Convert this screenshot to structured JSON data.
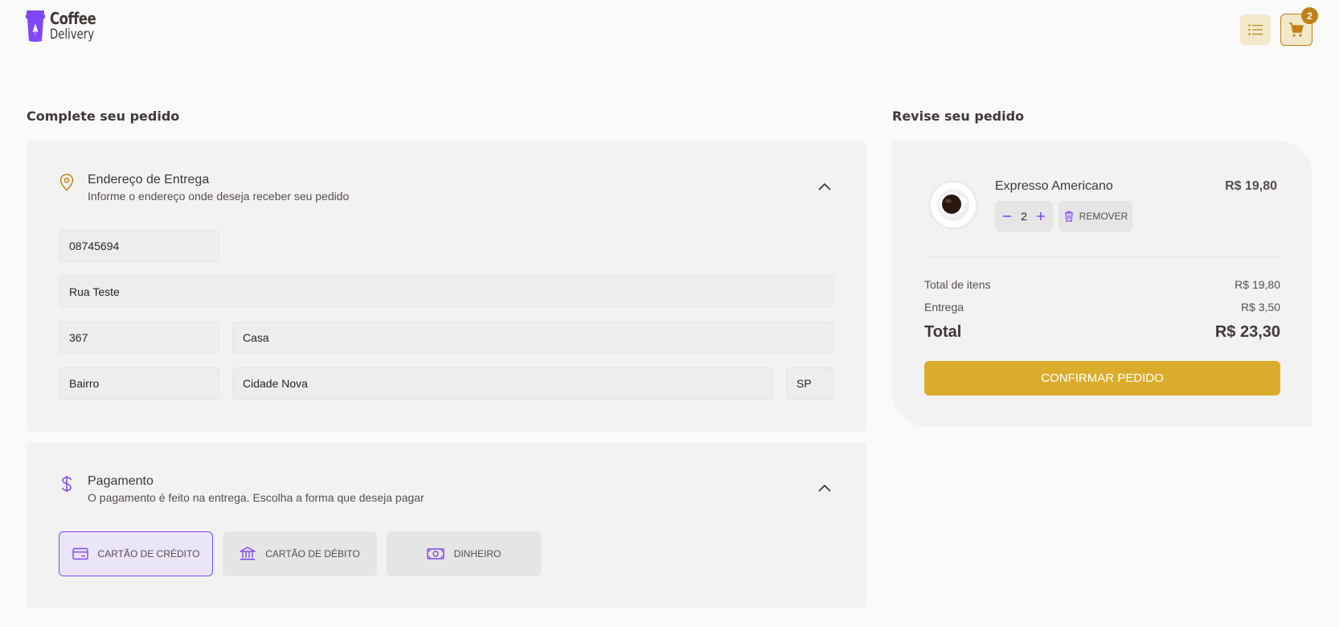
{
  "brand": {
    "line1": "Coffee",
    "line2": "Delivery"
  },
  "header": {
    "cart_count": "2"
  },
  "colors": {
    "purple": "#8047f8",
    "yellow_dark": "#c47f17",
    "yellow": "#dbac2c"
  },
  "checkout": {
    "title": "Complete seu pedido",
    "address": {
      "title": "Endereço de Entrega",
      "subtitle": "Informe o endereço onde deseja receber seu pedido",
      "cep": "08745694",
      "street": "Rua Teste",
      "number": "367",
      "complement": "Casa",
      "neighborhood": "Bairro",
      "city": "Cidade Nova",
      "uf": "SP"
    },
    "payment": {
      "title": "Pagamento",
      "subtitle": "O pagamento é feito na entrega. Escolha a forma que deseja pagar",
      "options": [
        {
          "label": "Cartão de crédito",
          "icon": "credit-card-icon",
          "selected": true
        },
        {
          "label": "Cartão de débito",
          "icon": "bank-icon",
          "selected": false
        },
        {
          "label": "Dinheiro",
          "icon": "money-icon",
          "selected": false
        }
      ]
    }
  },
  "review": {
    "title": "Revise seu pedido",
    "item": {
      "name": "Expresso Americano",
      "price": "R$ 19,80",
      "quantity": "2",
      "remove_label": "Remover"
    },
    "totals": {
      "items_label": "Total de itens",
      "items_value": "R$ 19,80",
      "delivery_label": "Entrega",
      "delivery_value": "R$ 3,50",
      "total_label": "Total",
      "total_value": "R$ 23,30"
    },
    "confirm_label": "Confirmar pedido"
  }
}
